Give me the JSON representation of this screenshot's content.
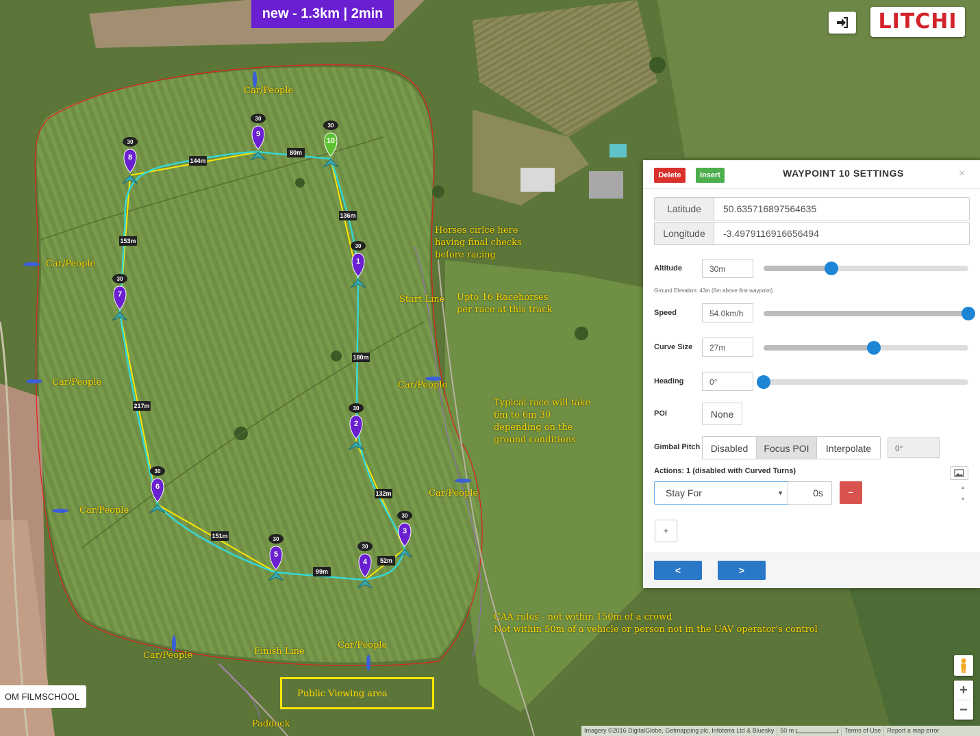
{
  "header": {
    "mission_title": "new - 1.3km | 2min",
    "logo": "LITCHI"
  },
  "watermark": "OM FILMSCHOOL",
  "annotations": {
    "car_people": "Car/People",
    "horses_circle": [
      "Horses cirlce here",
      "having final checks",
      "before racing"
    ],
    "start_line": "Start Line",
    "racehorses": [
      "Upto 16 Racehorses",
      "per race at this track"
    ],
    "typical_race": [
      "Typical race will take",
      "6m to 6m 30",
      "depending on the",
      "ground conditions"
    ],
    "caa_rules": [
      "CAA rules - not within 150m of a crowd",
      "Not within 50m of a vehicle or person not in the UAV operator's control"
    ],
    "finish_line": "Finish Line",
    "public_viewing": "Public Viewing area",
    "paddock": "Paddock"
  },
  "waypoints": [
    {
      "num": "1",
      "alt": "30"
    },
    {
      "num": "2",
      "alt": "30"
    },
    {
      "num": "3",
      "alt": "30"
    },
    {
      "num": "4",
      "alt": "30"
    },
    {
      "num": "5",
      "alt": "30"
    },
    {
      "num": "6",
      "alt": "30"
    },
    {
      "num": "7",
      "alt": "30"
    },
    {
      "num": "8",
      "alt": "30"
    },
    {
      "num": "9",
      "alt": "30"
    },
    {
      "num": "10",
      "alt": "30"
    }
  ],
  "distances": [
    "136m",
    "180m",
    "132m",
    "52m",
    "99m",
    "151m",
    "217m",
    "153m",
    "144m",
    "80m"
  ],
  "panel": {
    "delete_label": "Delete",
    "insert_label": "Insert",
    "title": "WAYPOINT 10 SETTINGS",
    "close": "×",
    "latitude_label": "Latitude",
    "latitude": "50.635716897564635",
    "longitude_label": "Longitude",
    "longitude": "-3.4979116916656494",
    "altitude_label": "Altitude",
    "altitude": "30m",
    "altitude_level": 0.33,
    "ground_elevation": "Ground Elevation: 43m (6m above first waypoint)",
    "speed_label": "Speed",
    "speed": "54.0km/h",
    "speed_level": 1.0,
    "curve_label": "Curve Size",
    "curve": "27m",
    "curve_level": 0.54,
    "heading_label": "Heading",
    "heading": "0°",
    "heading_level": 0.0,
    "poi_label": "POI",
    "poi_value": "None",
    "gimbal_label": "Gimbal Pitch",
    "gimbal_options": [
      "Disabled",
      "Focus POI",
      "Interpolate"
    ],
    "gimbal_value": "0°",
    "actions_label": "Actions: 1 (disabled with Curved Turns)",
    "action_type": "Stay For",
    "action_value": "0s",
    "remove_label": "−",
    "add_label": "+",
    "prev_label": "<",
    "next_label": ">"
  },
  "map_controls": {
    "zoom_in": "+",
    "zoom_out": "−"
  },
  "attribution": [
    "Imagery ©2016 DigitalGlobe, Getmapping plc, Infoterra Ltd & Bluesky",
    "50 m",
    "Terms of Use",
    "Report a map error"
  ],
  "colors": {
    "accent": "#6a1fd1",
    "waypoint": "#6a1fd1",
    "active_waypoint": "#5cc12e",
    "route": "#ffe600",
    "curve": "#34d6d6",
    "boundary": "#e0201a",
    "label": "#ffd700"
  }
}
